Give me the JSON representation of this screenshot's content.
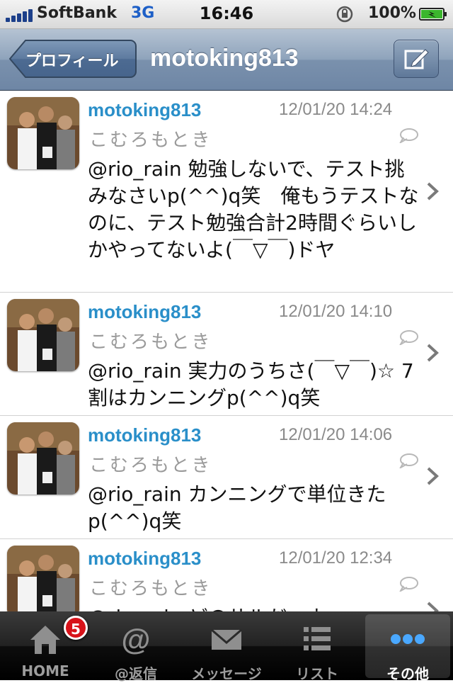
{
  "status_bar": {
    "carrier": "SoftBank",
    "network": "3G",
    "time": "16:46",
    "battery": "100%"
  },
  "nav": {
    "back_label": "プロフィール",
    "title": "motoking813",
    "compose_icon": "compose-icon"
  },
  "tweets": [
    {
      "screen_name": "motoking813",
      "display_name": "こむろもとき",
      "timestamp": "12/01/20 14:24",
      "text": "@rio_rain 勉強しないで、テスト挑みなさいp(^^)q笑　俺もうテストなのに、テスト勉強合計2時間ぐらいしかやってないよ(￣▽￣)ドヤ"
    },
    {
      "screen_name": "motoking813",
      "display_name": "こむろもとき",
      "timestamp": "12/01/20 14:10",
      "text": "@rio_rain 実力のうちさ(￣▽￣)☆ 7割はカンニングp(^^)q笑"
    },
    {
      "screen_name": "motoking813",
      "display_name": "こむろもとき",
      "timestamp": "12/01/20 14:06",
      "text": "@rio_rain カンニングで単位きたp(^^)q笑"
    },
    {
      "screen_name": "motoking813",
      "display_name": "こむろもとき",
      "timestamp": "12/01/20 12:34",
      "text": "@rio_rain どのサルだーよ"
    }
  ],
  "tabbar": {
    "tabs": [
      {
        "label": "HOME",
        "icon": "home-icon",
        "badge": "5"
      },
      {
        "label": "@返信",
        "icon": "at-icon"
      },
      {
        "label": "メッセージ",
        "icon": "envelope-icon"
      },
      {
        "label": "リスト",
        "icon": "list-icon"
      },
      {
        "label": "その他",
        "icon": "more-icon"
      }
    ],
    "active_index": 4
  }
}
